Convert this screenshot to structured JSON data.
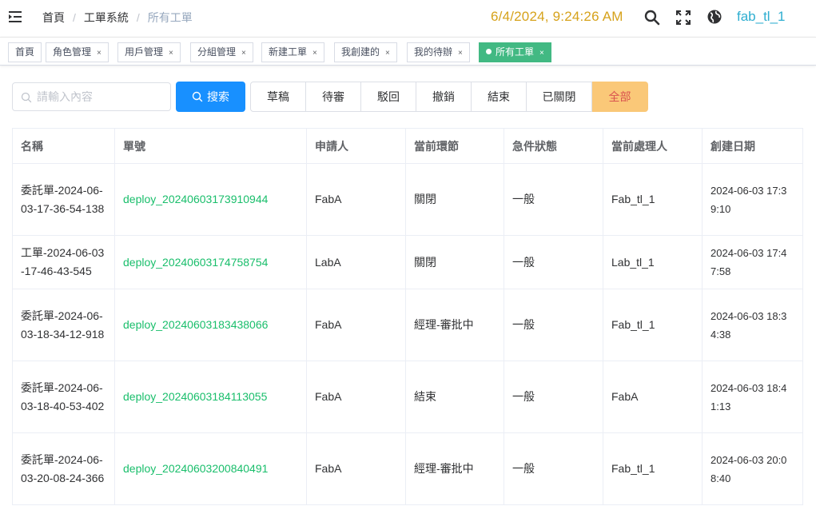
{
  "header": {
    "breadcrumb": [
      "首頁",
      "工單系統",
      "所有工單"
    ],
    "datetime": "6/4/2024, 9:24:26 AM",
    "username": "fab_tl_1",
    "icons": [
      "search-icon",
      "fullscreen-icon",
      "language-globe-icon"
    ]
  },
  "tags": [
    {
      "label": "首頁",
      "closable": false
    },
    {
      "label": "角色管理",
      "closable": true
    },
    {
      "label": "用戶管理",
      "closable": true
    },
    {
      "label": "分組管理",
      "closable": true
    },
    {
      "label": "新建工單",
      "closable": true
    },
    {
      "label": "我創建的",
      "closable": true
    },
    {
      "label": "我的待辦",
      "closable": true
    },
    {
      "label": "所有工單",
      "closable": true,
      "active": true
    }
  ],
  "tag_close": "×",
  "toolbar": {
    "search_placeholder": "請輸入內容",
    "search_value": "",
    "search_button": "搜索",
    "statuses": [
      "草稿",
      "待審",
      "駁回",
      "撤銷",
      "結束",
      "已關閉",
      "全部"
    ],
    "selected_status": "全部"
  },
  "colors": {
    "primary": "#1890ff",
    "tag_active": "#42b983",
    "link": "#19be6b",
    "clock": "#d6a21b",
    "username": "#2eaed0",
    "selected_status_bg": "#fac878",
    "selected_status_text": "#d9534f"
  },
  "table": {
    "columns": [
      "名稱",
      "單號",
      "申請人",
      "當前環節",
      "急件狀態",
      "當前處理人",
      "創建日期"
    ],
    "rows": [
      [
        "委託單-2024-06-03-17-36-54-138",
        "deploy_20240603173910944",
        "FabA",
        "關閉",
        "一般",
        "Fab_tl_1",
        "2024-06-03 17:39:10"
      ],
      [
        "工單-2024-06-03-17-46-43-545",
        "deploy_20240603174758754",
        "LabA",
        "關閉",
        "一般",
        "Lab_tl_1",
        "2024-06-03 17:47:58"
      ],
      [
        "委託單-2024-06-03-18-34-12-918",
        "deploy_20240603183438066",
        "FabA",
        "經理-審批中",
        "一般",
        "Fab_tl_1",
        "2024-06-03 18:34:38"
      ],
      [
        "委託單-2024-06-03-18-40-53-402",
        "deploy_20240603184113055",
        "FabA",
        "結束",
        "一般",
        "FabA",
        "2024-06-03 18:41:13"
      ],
      [
        "委託單-2024-06-03-20-08-24-366",
        "deploy_20240603200840491",
        "FabA",
        "經理-審批中",
        "一般",
        "Fab_tl_1",
        "2024-06-03 20:08:40"
      ]
    ]
  }
}
